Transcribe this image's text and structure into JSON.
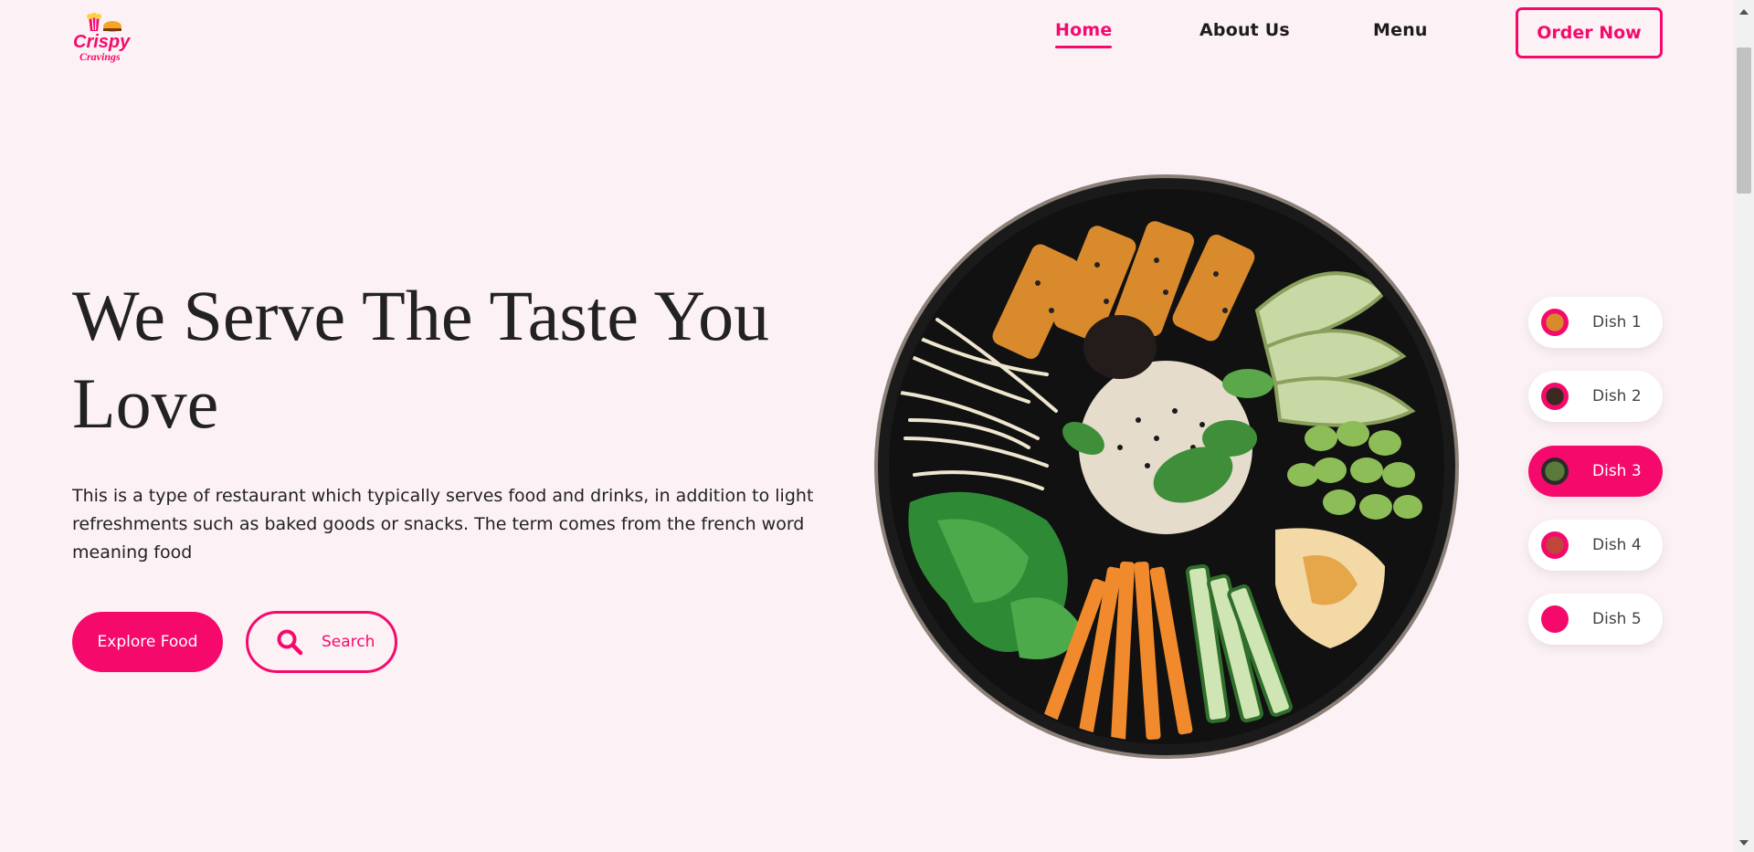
{
  "brand": {
    "logo_alt": "Crispy Cravings",
    "logo_word_1": "Crispy",
    "logo_word_2": "Cravings",
    "accent_color": "#f50a6c"
  },
  "nav": {
    "items": [
      {
        "label": "Home",
        "active": true
      },
      {
        "label": "About Us",
        "active": false
      },
      {
        "label": "Menu",
        "active": false
      }
    ],
    "cta_label": "Order Now"
  },
  "hero": {
    "title": "We Serve The Taste You Love",
    "description": "This is a type of restaurant which typically serves food and drinks, in addition to light refreshments such as baked goods or snacks. The term comes from the french word meaning food",
    "primary_button": "Explore Food",
    "search_button": "Search",
    "search_icon": "search-icon",
    "image": "food-bowl-image"
  },
  "dishes": {
    "items": [
      {
        "label": "Dish 1",
        "active": false,
        "thumb_color": "#c8773a"
      },
      {
        "label": "Dish 2",
        "active": false,
        "thumb_color": "#3a2a22"
      },
      {
        "label": "Dish 3",
        "active": true,
        "thumb_color": "#5a7a3a"
      },
      {
        "label": "Dish 4",
        "active": false,
        "thumb_color": "#c0453a"
      },
      {
        "label": "Dish 5",
        "active": false,
        "thumb_color": "#f50a6c"
      }
    ]
  }
}
